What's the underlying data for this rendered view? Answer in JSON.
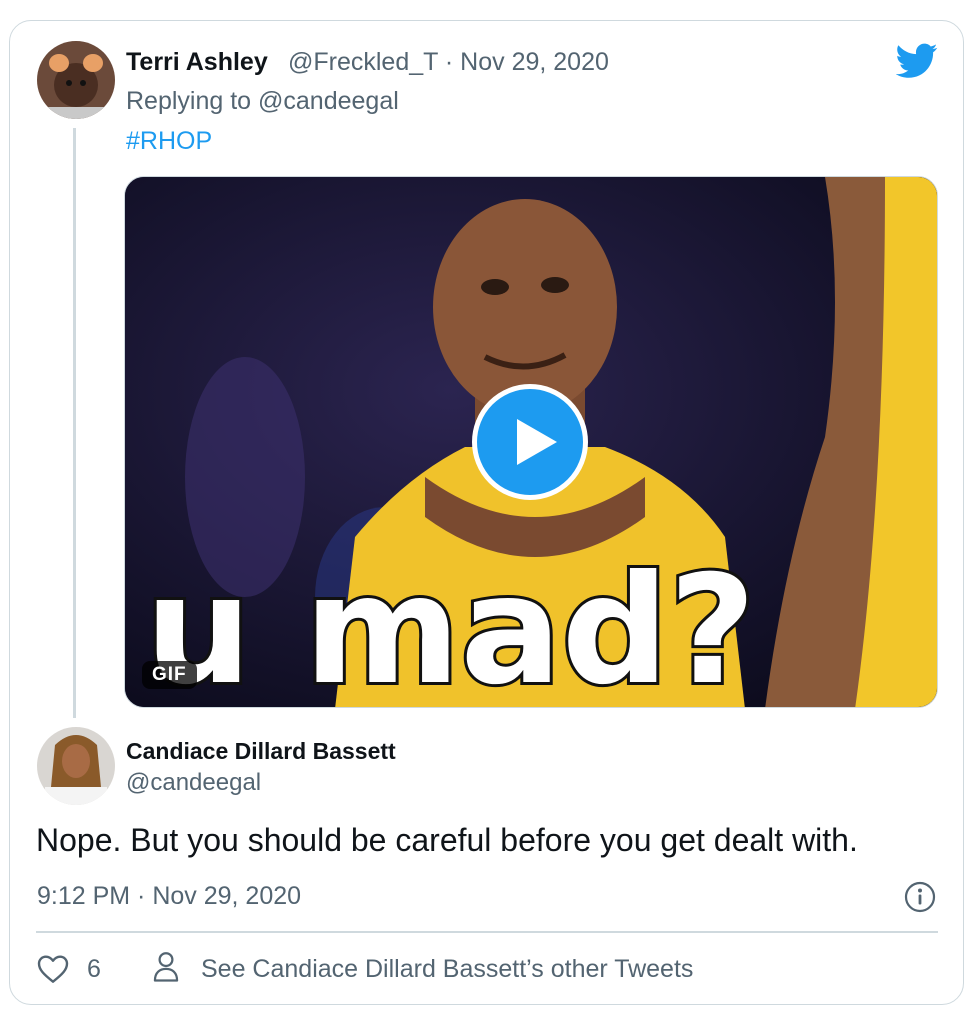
{
  "original_tweet": {
    "author_name": "Terri Ashley",
    "handle_and_date": "@Freckled_T · Nov 29, 2020",
    "replying_to": "Replying to @candeegal",
    "hashtag": "#RHOP",
    "media": {
      "gif_badge": "GIF",
      "caption_text": "u mad?"
    }
  },
  "reply_tweet": {
    "author_name": "Candiace Dillard Bassett",
    "handle": "@candeegal",
    "text": "Nope. But you should be careful before you get dealt with.",
    "timestamp": "9:12 PM · Nov 29, 2020",
    "like_count": "6",
    "other_tweets_link": "See Candiace Dillard Bassett’s other Tweets"
  },
  "colors": {
    "accent": "#1d9bf0",
    "text": "#0f1419",
    "secondary_text": "#536471",
    "border": "#cfd9de"
  },
  "icons": [
    "twitter-bird-icon",
    "play-icon",
    "info-icon",
    "heart-icon",
    "person-icon"
  ]
}
